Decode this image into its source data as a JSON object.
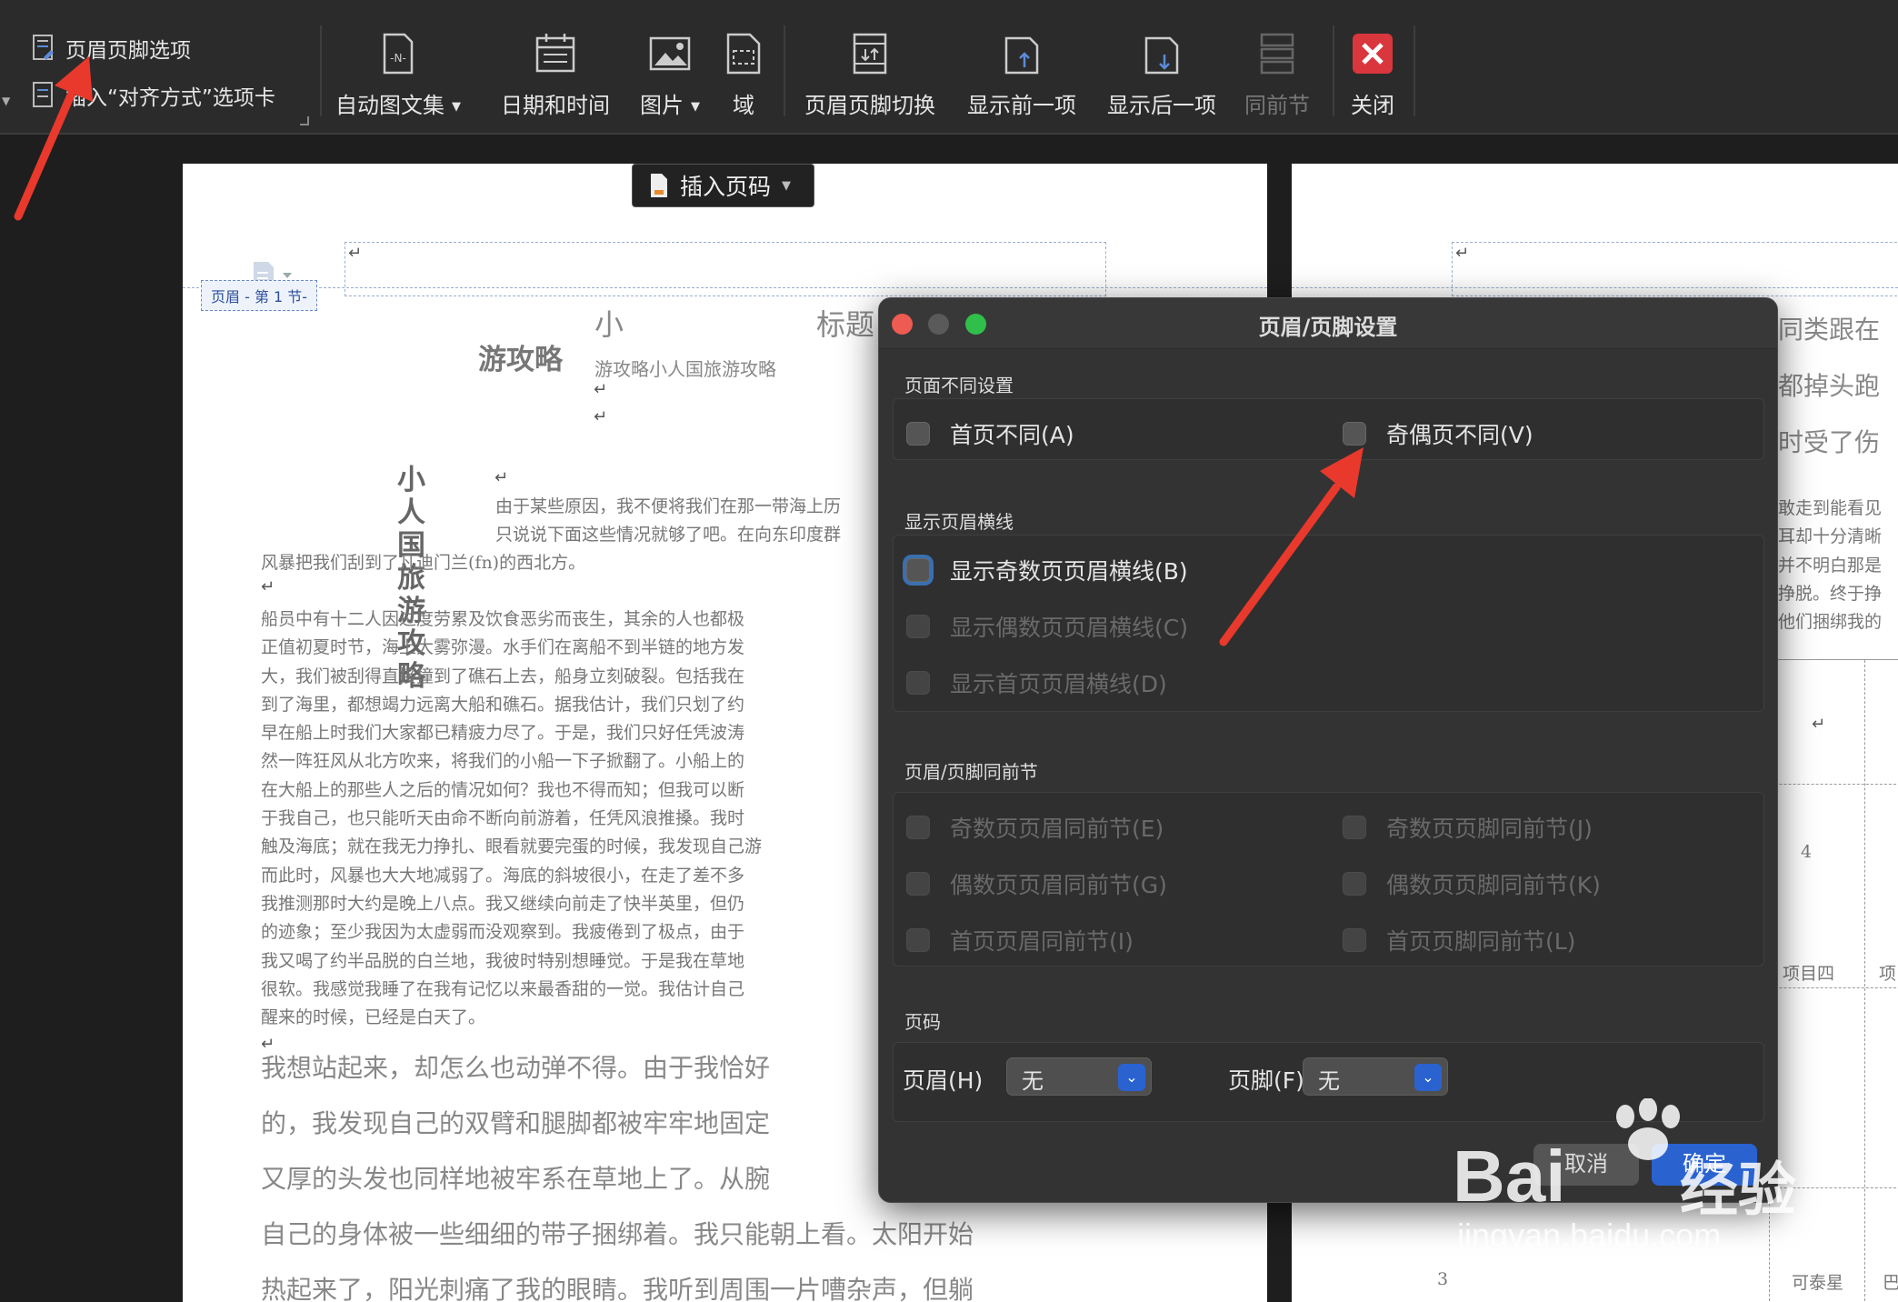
{
  "toolbar": {
    "options_top": "页眉页脚选项",
    "options_bottom": "插入“对齐方式”选项卡",
    "buttons": [
      {
        "label": "自动图文集",
        "dropdown": true,
        "icon": "autotext-icon"
      },
      {
        "label": "日期和时间",
        "icon": "calendar-icon"
      },
      {
        "label": "图片",
        "dropdown": true,
        "icon": "image-icon"
      },
      {
        "label": "域",
        "icon": "field-icon"
      },
      {
        "label": "页眉页脚切换",
        "icon": "header-footer-switch-icon"
      },
      {
        "label": "显示前一项",
        "icon": "show-previous-icon"
      },
      {
        "label": "显示后一项",
        "icon": "show-next-icon"
      },
      {
        "label": "同前节",
        "icon": "same-as-previous-icon"
      },
      {
        "label": "关闭",
        "icon": "close-icon"
      }
    ]
  },
  "document": {
    "header_tag": "页眉 - 第 1 节-",
    "insert_page_number": "插入页码",
    "vertical_title": "小人国旅游攻略",
    "title_fragment_left": "小",
    "title_fragment_right": "标题",
    "subtitle": "游攻略",
    "subtitle_small": "游攻略小人国旅游攻略",
    "para1": [
      "由于某些原因，我不便将我们在那一带海上历",
      "只说说下面这些情况就够了吧。在向东印度群",
      "风暴把我们刮到了凡迪门兰(fn)的西北方。"
    ],
    "para2": [
      "船员中有十二人因过度劳累及饮食恶劣而丧生，其余的人也都极",
      "正值初夏时节，海上大雾弥漫。水手们在离船不到半链的地方发",
      "大，我们被刮得直接撞到了礁石上去，船身立刻破裂。包括我在",
      "到了海里，都想竭力远离大船和礁石。据我估计，我们只划了约",
      "早在船上时我们大家都已精疲力尽了。于是，我们只好任凭波涛",
      "然一阵狂风从北方吹来，将我们的小船一下子掀翻了。小船上的",
      "在大船上的那些人之后的情况如何？我也不得而知；但我可以断",
      "于我自己，也只能听天由命不断向前游着，任凭风浪推搡。我时",
      "触及海底；就在我无力挣扎、眼看就要完蛋的时候，我发现自己游",
      "而此时，风暴也大大地减弱了。海底的斜坡很小，在走了差不多",
      "我推测那时大约是晚上八点。我又继续向前走了快半英里，但仍",
      "的迹象；至少我因为太虚弱而没观察到。我疲倦到了极点，由于",
      "我又喝了约半品脱的白兰地，我彼时特别想睡觉。于是我在草地",
      "很软。我感觉我睡了在我有记忆以来最香甜的一觉。我估计自己",
      "醒来的时候，已经是白天了。"
    ],
    "para3": [
      "我想站起来，却怎么也动弹不得。由于我恰好",
      "的，我发现自己的双臂和腿脚都被牢牢地固定",
      "又厚的头发也同样地被牢系在草地上了。从腕",
      "自己的身体被一些细细的带子捆绑着。我只能朝上看。太阳开始",
      "热起来了，阳光刺痛了我的眼睛。我听到周围一片嘈杂声，但躺"
    ],
    "page2_lines": [
      "同类跟在",
      "都掉头跑",
      "时受了伤"
    ],
    "page2_small": [
      "敢走到能看见",
      "耳却十分清晰",
      "并不明白那是",
      "挣脱。终于挣",
      "他们捆绑我的"
    ],
    "page2_table": [
      "4",
      "项目四",
      "项目",
      "3",
      "可泰星",
      "巴"
    ]
  },
  "dialog": {
    "title": "页眉/页脚设置",
    "section_diff": "页面不同设置",
    "first_page_diff": "首页不同(A)",
    "odd_even_diff": "奇偶页不同(V)",
    "section_lines": "显示页眉横线",
    "show_odd_line": "显示奇数页页眉横线(B)",
    "show_even_line": "显示偶数页页眉横线(C)",
    "show_first_line": "显示首页页眉横线(D)",
    "section_same": "页眉/页脚同前节",
    "odd_header_same": "奇数页页眉同前节(E)",
    "odd_footer_same": "奇数页页脚同前节(J)",
    "even_header_same": "偶数页页眉同前节(G)",
    "even_footer_same": "偶数页页脚同前节(K)",
    "first_header_same": "首页页眉同前节(I)",
    "first_footer_same": "首页页脚同前节(L)",
    "section_pn": "页码",
    "header_label": "页眉(H)",
    "header_value": "无",
    "footer_label": "页脚(F)",
    "footer_value": "无",
    "cancel": "取消",
    "ok": "确定"
  },
  "watermark": {
    "brand": "Bai",
    "brand2": "经验",
    "url": "jingyan.baidu.com"
  },
  "colors": {
    "accent": "#2a63d0",
    "close": "#d9363e",
    "arrow": "#e8392c",
    "light_red": "#ee5b52",
    "light_yellow": "#5a5a5a",
    "light_green": "#2fbf4a"
  }
}
